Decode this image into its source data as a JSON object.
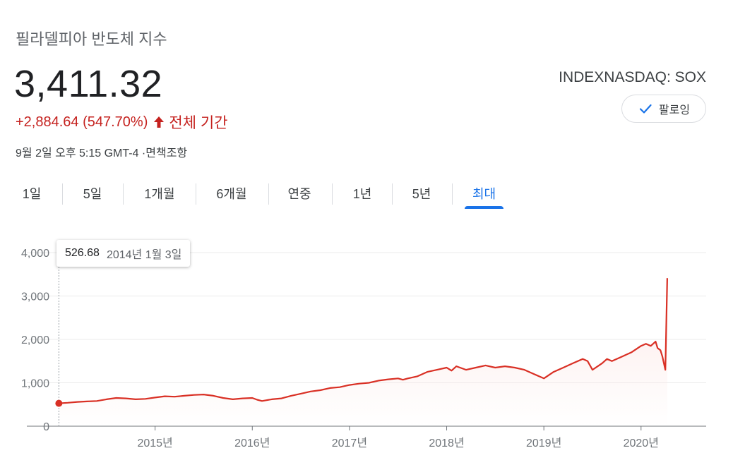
{
  "header": {
    "title": "필라델피아 반도체 지수",
    "price": "3,411.32",
    "change": "+2,884.64 (547.70%)",
    "change_period": "전체 기간",
    "timestamp": "9월 2일 오후 5:15 GMT-4 ·면책조항",
    "ticker": "INDEXNASDAQ: SOX",
    "follow_label": "팔로잉"
  },
  "tabs": [
    {
      "label": "1일",
      "active": false
    },
    {
      "label": "5일",
      "active": false
    },
    {
      "label": "1개월",
      "active": false
    },
    {
      "label": "6개월",
      "active": false
    },
    {
      "label": "연중",
      "active": false
    },
    {
      "label": "1년",
      "active": false
    },
    {
      "label": "5년",
      "active": false
    },
    {
      "label": "최대",
      "active": true
    }
  ],
  "tooltip": {
    "value": "526.68",
    "date": "2014년 1월 3일"
  },
  "colors": {
    "line": "#d93025",
    "accent": "#1a73e8",
    "change": "#c5221f"
  },
  "chart_data": {
    "type": "area",
    "x_unit": "decimal year",
    "xlim": [
      2014.0,
      2020.67
    ],
    "ylim": [
      0,
      4000
    ],
    "yticks": [
      0,
      1000,
      2000,
      3000,
      4000
    ],
    "ytick_labels": [
      "0",
      "1,000",
      "2,000",
      "3,000",
      "4,000"
    ],
    "xticks": [
      2015,
      2016,
      2017,
      2018,
      2019,
      2020
    ],
    "xtick_labels": [
      "2015년",
      "2016년",
      "2017년",
      "2018년",
      "2019년",
      "2020년"
    ],
    "grid": true,
    "highlight": {
      "x": 2014.01,
      "y": 526.68
    },
    "series": [
      {
        "x": [
          2014.01,
          2014.1,
          2014.2,
          2014.3,
          2014.4,
          2014.5,
          2014.6,
          2014.7,
          2014.8,
          2014.9,
          2015.0,
          2015.1,
          2015.2,
          2015.3,
          2015.4,
          2015.5,
          2015.6,
          2015.7,
          2015.8,
          2015.9,
          2016.0,
          2016.05,
          2016.1,
          2016.2,
          2016.3,
          2016.4,
          2016.5,
          2016.6,
          2016.7,
          2016.8,
          2016.9,
          2017.0,
          2017.1,
          2017.2,
          2017.3,
          2017.4,
          2017.5,
          2017.55,
          2017.6,
          2017.7,
          2017.8,
          2017.9,
          2018.0,
          2018.05,
          2018.1,
          2018.2,
          2018.3,
          2018.4,
          2018.5,
          2018.6,
          2018.7,
          2018.8,
          2018.9,
          2019.0,
          2019.1,
          2019.2,
          2019.3,
          2019.4,
          2019.45,
          2019.5,
          2019.6,
          2019.65,
          2019.7,
          2019.8,
          2019.9,
          2020.0,
          2020.05,
          2020.1,
          2020.15,
          2020.17,
          2020.2,
          2020.22,
          2020.25,
          2020.27
        ],
        "values": [
          526.68,
          540,
          560,
          570,
          580,
          620,
          650,
          640,
          620,
          630,
          660,
          690,
          680,
          700,
          720,
          730,
          700,
          650,
          620,
          640,
          650,
          610,
          580,
          620,
          640,
          700,
          750,
          800,
          830,
          880,
          900,
          950,
          980,
          1000,
          1050,
          1080,
          1100,
          1070,
          1100,
          1150,
          1250,
          1300,
          1350,
          1280,
          1380,
          1300,
          1350,
          1400,
          1350,
          1380,
          1350,
          1300,
          1200,
          1100,
          1250,
          1350,
          1450,
          1550,
          1500,
          1300,
          1450,
          1550,
          1500,
          1600,
          1700,
          1850,
          1900,
          1850,
          1950,
          1800,
          1750,
          1600,
          1300,
          3411.32
        ]
      }
    ]
  }
}
